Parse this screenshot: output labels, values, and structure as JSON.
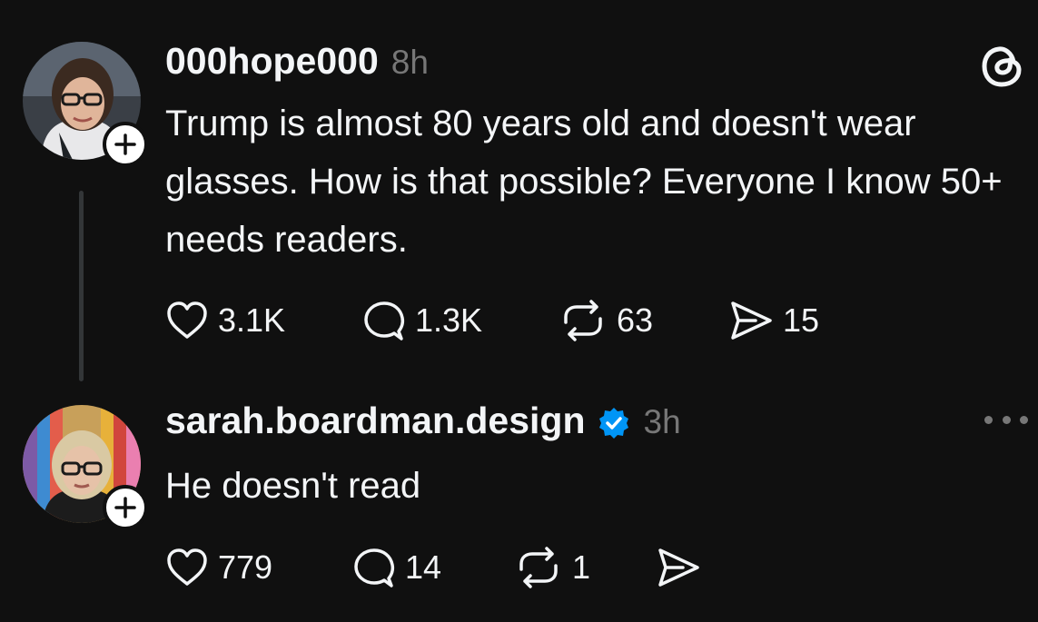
{
  "app": {
    "logo_icon": "threads-logo-icon"
  },
  "original_post": {
    "username": "000hope000",
    "time": "8h",
    "text": "Trump is almost 80 years old and doesn't wear glasses. How is that possible? Everyone I know 50+ needs readers.",
    "actions": {
      "likes": "3.1K",
      "replies": "1.3K",
      "reposts": "63",
      "shares": "15"
    }
  },
  "reply_post": {
    "username": "sarah.boardman.design",
    "verified": true,
    "time": "3h",
    "text": "He doesn't read",
    "actions": {
      "likes": "779",
      "replies": "14",
      "reposts": "1",
      "shares": ""
    }
  },
  "colors": {
    "background": "#101010",
    "text_primary": "#f3f5f7",
    "text_secondary": "#777777",
    "verified_blue": "#0095f6",
    "thread_line": "#333638"
  }
}
